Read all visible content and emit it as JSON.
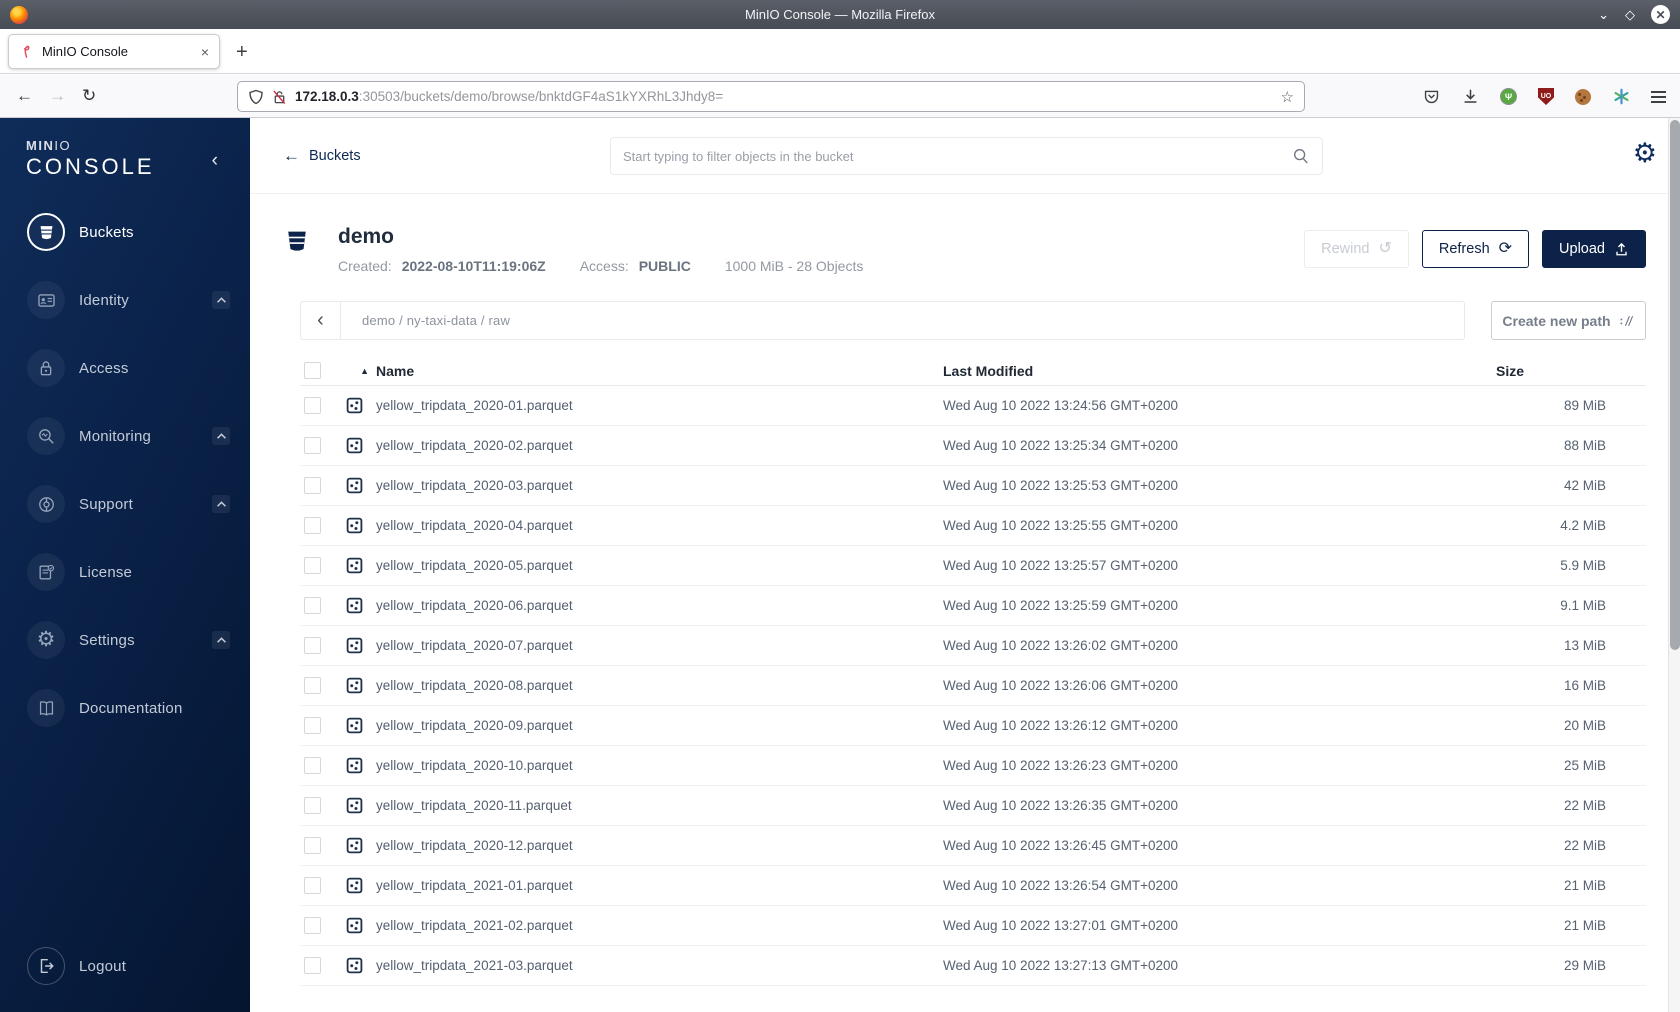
{
  "browser": {
    "window_title": "MinIO Console — Mozilla Firefox",
    "tab_title": "MinIO Console",
    "tab_close": "×",
    "new_tab": "+",
    "back": "←",
    "forward": "→",
    "reload": "↻",
    "url_host": "172.18.0.3",
    "url_rest": ":30503/buckets/demo/browse/bnktdGF4aS1kYXRhL3Jhdy8=",
    "bookmark_star": "☆",
    "minimize": "⌄",
    "maximize": "◇",
    "close": "✕"
  },
  "sidebar": {
    "logo_bold": "MIN",
    "logo_light": "IO",
    "logo_line2": "CONSOLE",
    "collapse": "‹",
    "items": [
      {
        "label": "Buckets",
        "icon": "bucket",
        "active": true,
        "expandable": false
      },
      {
        "label": "Identity",
        "icon": "identity",
        "active": false,
        "expandable": true
      },
      {
        "label": "Access",
        "icon": "lock",
        "active": false,
        "expandable": false
      },
      {
        "label": "Monitoring",
        "icon": "monitoring",
        "active": false,
        "expandable": true
      },
      {
        "label": "Support",
        "icon": "support",
        "active": false,
        "expandable": true
      },
      {
        "label": "License",
        "icon": "license",
        "active": false,
        "expandable": false
      },
      {
        "label": "Settings",
        "icon": "gear",
        "active": false,
        "expandable": true
      },
      {
        "label": "Documentation",
        "icon": "book",
        "active": false,
        "expandable": false
      }
    ],
    "logout_label": "Logout"
  },
  "topbar": {
    "back_label": "Buckets",
    "search_placeholder": "Start typing to filter objects in the bucket",
    "gear": "⚙"
  },
  "bucket": {
    "name": "demo",
    "created_label": "Created:",
    "created_value": "2022-08-10T11:19:06Z",
    "access_label": "Access:",
    "access_value": "PUBLIC",
    "summary": "1000 MiB - 28 Objects",
    "rewind_label": "Rewind",
    "rewind_icon": "↺",
    "refresh_label": "Refresh",
    "refresh_icon": "⟳",
    "upload_label": "Upload"
  },
  "path": {
    "back_chevron": "‹",
    "breadcrumb": "demo / ny-taxi-data / raw",
    "create_label": "Create new path"
  },
  "table": {
    "sort_indicator": "▲",
    "headers": {
      "name": "Name",
      "modified": "Last Modified",
      "size": "Size"
    },
    "rows": [
      {
        "name": "yellow_tripdata_2020-01.parquet",
        "modified": "Wed Aug 10 2022 13:24:56 GMT+0200",
        "size": "89 MiB"
      },
      {
        "name": "yellow_tripdata_2020-02.parquet",
        "modified": "Wed Aug 10 2022 13:25:34 GMT+0200",
        "size": "88 MiB"
      },
      {
        "name": "yellow_tripdata_2020-03.parquet",
        "modified": "Wed Aug 10 2022 13:25:53 GMT+0200",
        "size": "42 MiB"
      },
      {
        "name": "yellow_tripdata_2020-04.parquet",
        "modified": "Wed Aug 10 2022 13:25:55 GMT+0200",
        "size": "4.2 MiB"
      },
      {
        "name": "yellow_tripdata_2020-05.parquet",
        "modified": "Wed Aug 10 2022 13:25:57 GMT+0200",
        "size": "5.9 MiB"
      },
      {
        "name": "yellow_tripdata_2020-06.parquet",
        "modified": "Wed Aug 10 2022 13:25:59 GMT+0200",
        "size": "9.1 MiB"
      },
      {
        "name": "yellow_tripdata_2020-07.parquet",
        "modified": "Wed Aug 10 2022 13:26:02 GMT+0200",
        "size": "13 MiB"
      },
      {
        "name": "yellow_tripdata_2020-08.parquet",
        "modified": "Wed Aug 10 2022 13:26:06 GMT+0200",
        "size": "16 MiB"
      },
      {
        "name": "yellow_tripdata_2020-09.parquet",
        "modified": "Wed Aug 10 2022 13:26:12 GMT+0200",
        "size": "20 MiB"
      },
      {
        "name": "yellow_tripdata_2020-10.parquet",
        "modified": "Wed Aug 10 2022 13:26:23 GMT+0200",
        "size": "25 MiB"
      },
      {
        "name": "yellow_tripdata_2020-11.parquet",
        "modified": "Wed Aug 10 2022 13:26:35 GMT+0200",
        "size": "22 MiB"
      },
      {
        "name": "yellow_tripdata_2020-12.parquet",
        "modified": "Wed Aug 10 2022 13:26:45 GMT+0200",
        "size": "22 MiB"
      },
      {
        "name": "yellow_tripdata_2021-01.parquet",
        "modified": "Wed Aug 10 2022 13:26:54 GMT+0200",
        "size": "21 MiB"
      },
      {
        "name": "yellow_tripdata_2021-02.parquet",
        "modified": "Wed Aug 10 2022 13:27:01 GMT+0200",
        "size": "21 MiB"
      },
      {
        "name": "yellow_tripdata_2021-03.parquet",
        "modified": "Wed Aug 10 2022 13:27:13 GMT+0200",
        "size": "29 MiB"
      }
    ]
  },
  "colors": {
    "navy": "#0d2248",
    "sidebar_top": "#0f2c59",
    "sidebar_bottom": "#041530",
    "titlebar": "#4c5158"
  }
}
